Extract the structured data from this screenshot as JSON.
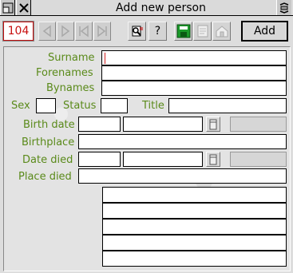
{
  "window": {
    "title": "Add new person"
  },
  "titlebar": {
    "back_icon": "back-icon",
    "close_icon": "close-icon",
    "toggle_icon": "toggle-size-icon"
  },
  "toolbar": {
    "record_number": "104",
    "help_label": "?",
    "add_label": "Add",
    "icons": [
      "first-icon",
      "previous-icon",
      "next-icon",
      "last-icon",
      "find-person-icon",
      "help-icon",
      "save-icon",
      "edit-icon",
      "home-icon"
    ]
  },
  "form": {
    "surname_label": "Surname",
    "surname_value": "",
    "forenames_label": "Forenames",
    "forenames_value": "",
    "bynames_label": "Bynames",
    "bynames_value": "",
    "sex_label": "Sex",
    "sex_value": "",
    "status_label": "Status",
    "status_value": "",
    "title_label": "Title",
    "title_value": "",
    "birth_date_label": "Birth date",
    "birthplace_label": "Birthplace",
    "date_died_label": "Date died",
    "place_died_label": "Place died",
    "notes_lines": 5
  },
  "colors": {
    "label_green": "#5a8a1a",
    "record_red": "#c81010",
    "caret_red": "#d02020"
  }
}
